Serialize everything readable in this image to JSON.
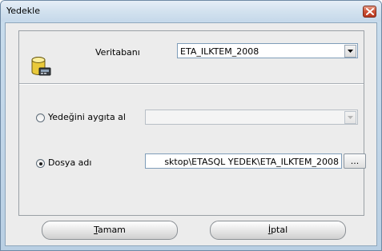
{
  "window": {
    "title": "Yedekle",
    "close_label": "X"
  },
  "database": {
    "label": "Veritabanı",
    "selected_value": "ETA_ILKTEM_2008",
    "icon": "database-icon"
  },
  "device_option": {
    "label": "Yedeğini aygıta al",
    "selected": false,
    "combo_value": ""
  },
  "file_option": {
    "label": "Dosya adı",
    "selected": true,
    "path_value": "sktop\\ETASQL YEDEK\\ETA_ILKTEM_2008",
    "browse_label": "..."
  },
  "buttons": {
    "ok_mnemonic": "T",
    "ok_rest": "amam",
    "cancel_mnemonic": "İ",
    "cancel_rest": "ptal"
  },
  "colors": {
    "close_button": "#cf553a",
    "frame": "#c8dcec"
  }
}
